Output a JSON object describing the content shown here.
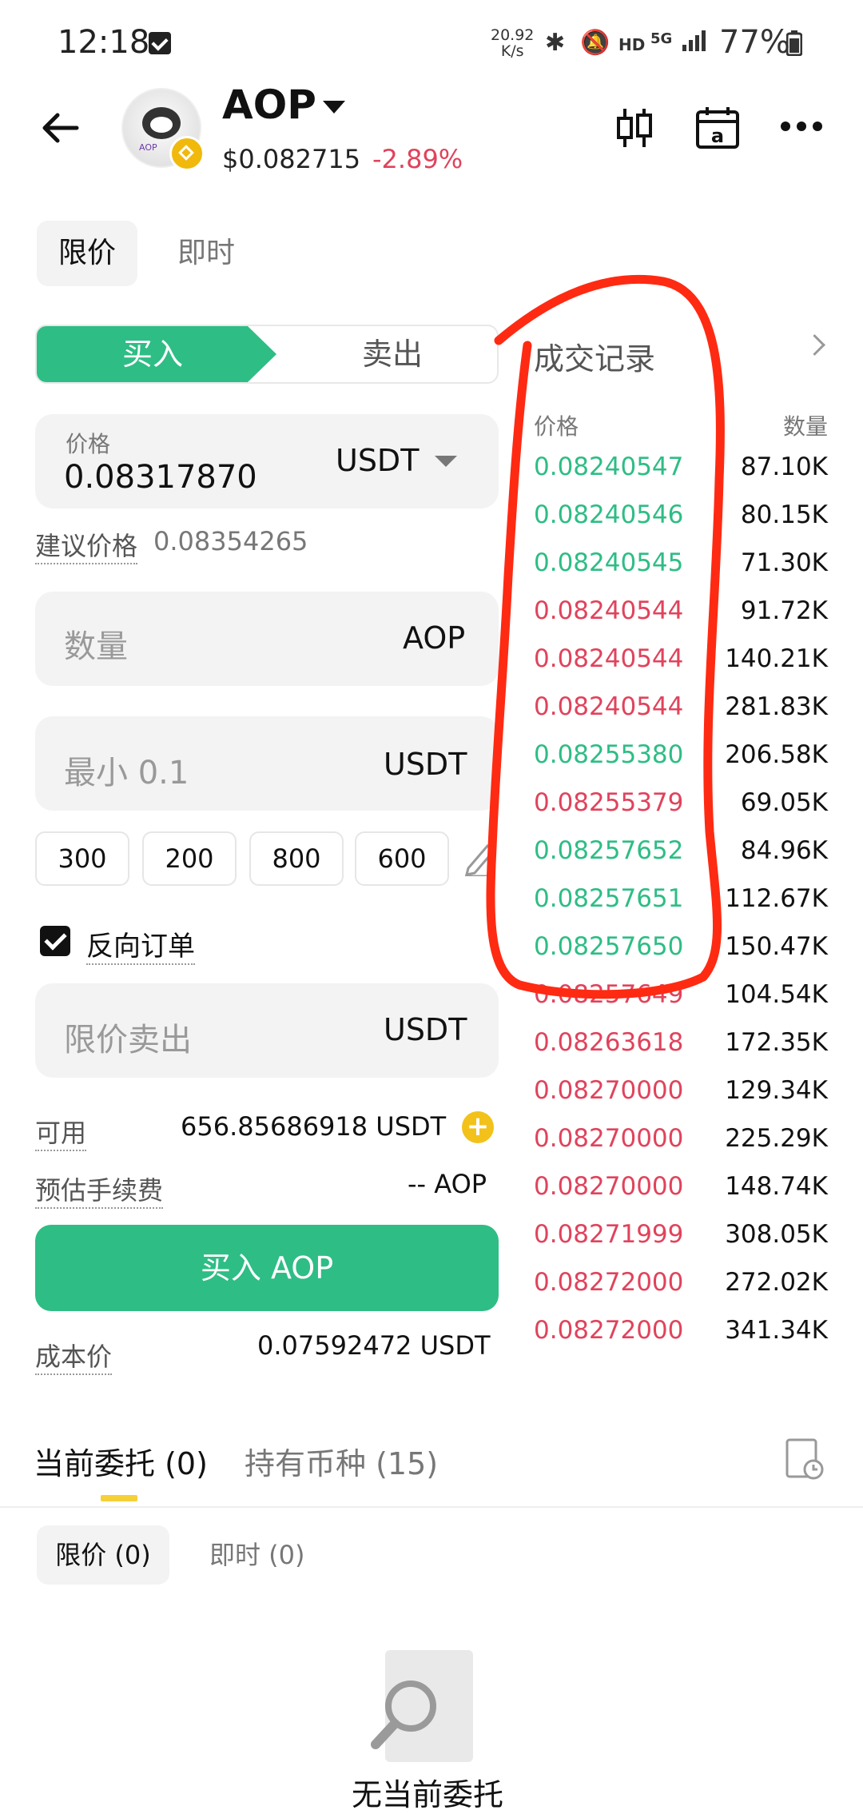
{
  "status_bar": {
    "time": "12:18",
    "net_speed_value": "20.92",
    "net_speed_unit": "K/s",
    "hd_label": "HD",
    "signal_label": "5G",
    "battery": "77%"
  },
  "header": {
    "symbol": "AOP",
    "price": "$0.082715",
    "change": "-2.89%"
  },
  "order_type_tabs": [
    "限价",
    "即时"
  ],
  "side_toggle": {
    "buy": "买入",
    "sell": "卖出"
  },
  "price_field": {
    "label": "价格",
    "value": "0.08317870",
    "unit": "USDT"
  },
  "suggested_price": {
    "label": "建议价格",
    "value": "0.08354265"
  },
  "quantity_field": {
    "placeholder": "数量",
    "unit": "AOP"
  },
  "amount_field": {
    "placeholder": "最小 0.1",
    "unit": "USDT"
  },
  "quick_amounts": [
    "300",
    "200",
    "800",
    "600"
  ],
  "reverse_order": {
    "label": "反向订单",
    "checked": true
  },
  "limit_sell_field": {
    "placeholder": "限价卖出",
    "unit": "USDT"
  },
  "available": {
    "label": "可用",
    "value": "656.85686918 USDT"
  },
  "est_fee": {
    "label": "预估手续费",
    "value": "-- AOP"
  },
  "buy_button": "买入 AOP",
  "cost_price": {
    "label": "成本价",
    "value": "0.07592472 USDT"
  },
  "trade_list": {
    "title": "成交记录",
    "price_header": "价格",
    "qty_header": "数量",
    "rows": [
      {
        "price": "0.08240547",
        "qty": "87.10K",
        "side": "buy"
      },
      {
        "price": "0.08240546",
        "qty": "80.15K",
        "side": "buy"
      },
      {
        "price": "0.08240545",
        "qty": "71.30K",
        "side": "buy"
      },
      {
        "price": "0.08240544",
        "qty": "91.72K",
        "side": "sell"
      },
      {
        "price": "0.08240544",
        "qty": "140.21K",
        "side": "sell"
      },
      {
        "price": "0.08240544",
        "qty": "281.83K",
        "side": "sell"
      },
      {
        "price": "0.08255380",
        "qty": "206.58K",
        "side": "buy"
      },
      {
        "price": "0.08255379",
        "qty": "69.05K",
        "side": "sell"
      },
      {
        "price": "0.08257652",
        "qty": "84.96K",
        "side": "buy"
      },
      {
        "price": "0.08257651",
        "qty": "112.67K",
        "side": "buy"
      },
      {
        "price": "0.08257650",
        "qty": "150.47K",
        "side": "buy"
      },
      {
        "price": "0.08257649",
        "qty": "104.54K",
        "side": "sell"
      },
      {
        "price": "0.08263618",
        "qty": "172.35K",
        "side": "sell"
      },
      {
        "price": "0.08270000",
        "qty": "129.34K",
        "side": "sell"
      },
      {
        "price": "0.08270000",
        "qty": "225.29K",
        "side": "sell"
      },
      {
        "price": "0.08270000",
        "qty": "148.74K",
        "side": "sell"
      },
      {
        "price": "0.08271999",
        "qty": "308.05K",
        "side": "sell"
      },
      {
        "price": "0.08272000",
        "qty": "272.02K",
        "side": "sell"
      },
      {
        "price": "0.08272000",
        "qty": "341.34K",
        "side": "sell"
      }
    ]
  },
  "bottom_tabs": [
    {
      "label": "当前委托 (0)"
    },
    {
      "label": "持有币种 (15)"
    }
  ],
  "bottom_subtabs": [
    "限价 (0)",
    "即时 (0)"
  ],
  "empty_state": "无当前委托",
  "colors": {
    "buy": "#2ebd85",
    "sell": "#e0435c",
    "annotation": "#ff2a12"
  }
}
